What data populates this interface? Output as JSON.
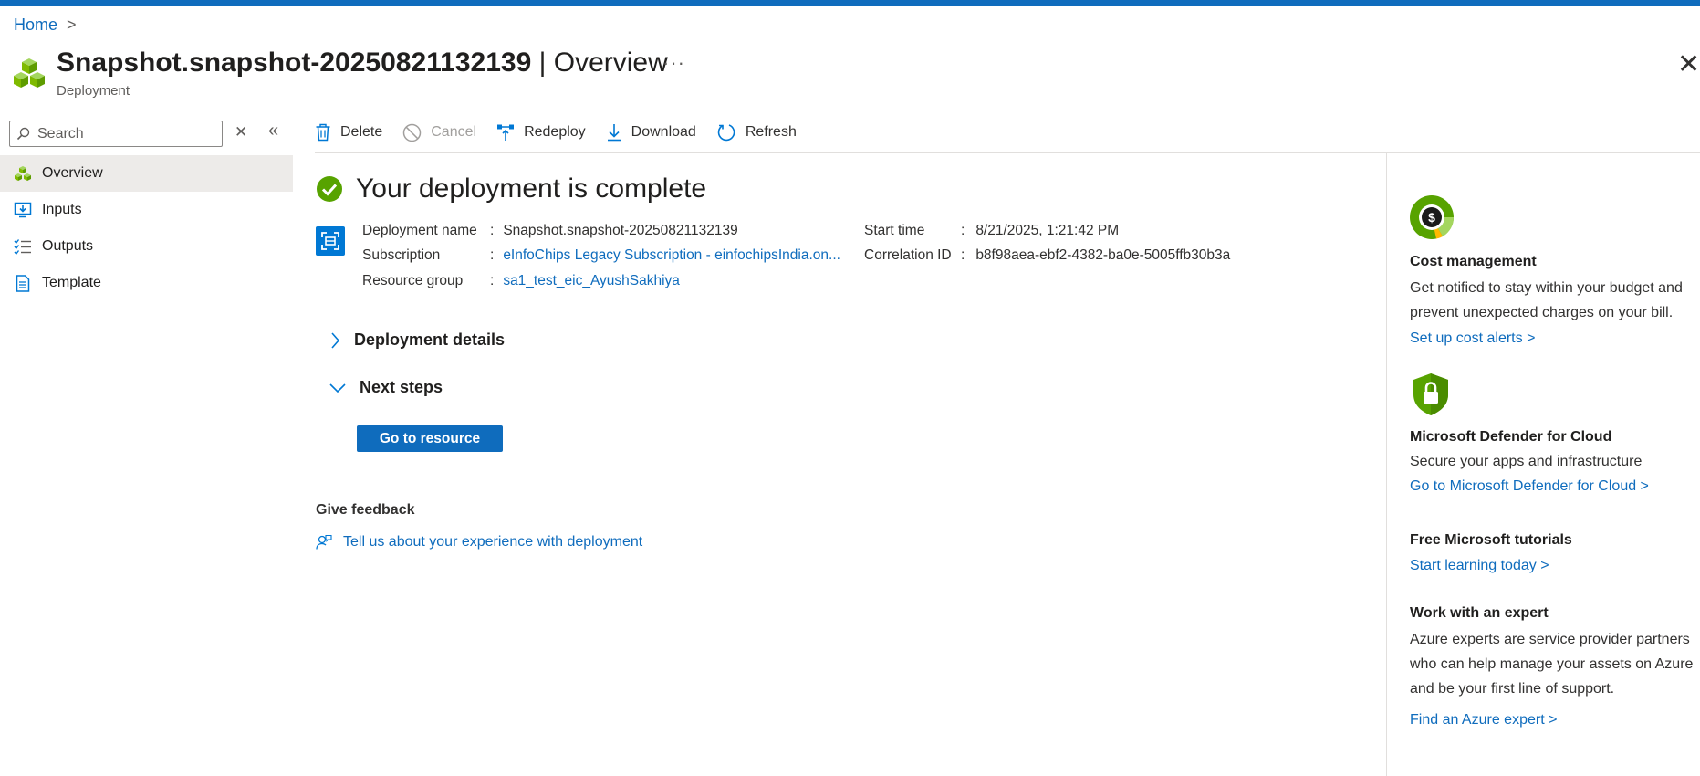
{
  "breadcrumb": {
    "home": "Home",
    "chevron": ">"
  },
  "header": {
    "name": "Snapshot.snapshot-20250821132139",
    "separator": " | ",
    "section": "Overview",
    "subtitle": "Deployment",
    "more": "···",
    "close": "✕"
  },
  "search": {
    "placeholder": "Search",
    "clear": "✕",
    "collapse": "«"
  },
  "sidebar": {
    "items": [
      {
        "label": "Overview",
        "icon": "overview-icon"
      },
      {
        "label": "Inputs",
        "icon": "inputs-icon"
      },
      {
        "label": "Outputs",
        "icon": "outputs-icon"
      },
      {
        "label": "Template",
        "icon": "template-icon"
      }
    ]
  },
  "toolbar": {
    "delete": "Delete",
    "cancel": "Cancel",
    "redeploy": "Redeploy",
    "download": "Download",
    "refresh": "Refresh"
  },
  "main": {
    "status": "Your deployment is complete",
    "details": {
      "deployment_name_label": "Deployment name",
      "deployment_name": "Snapshot.snapshot-20250821132139",
      "subscription_label": "Subscription",
      "subscription": "eInfoChips Legacy Subscription - einfochipsIndia.on...",
      "resource_group_label": "Resource group",
      "resource_group": "sa1_test_eic_AyushSakhiya",
      "start_time_label": "Start time",
      "start_time": "8/21/2025, 1:21:42 PM",
      "correlation_label": "Correlation ID",
      "correlation_id": "b8f98aea-ebf2-4382-ba0e-5005ffb30b3a",
      "colon": ":"
    },
    "deployment_details": "Deployment details",
    "next_steps": "Next steps",
    "go_to_resource": "Go to resource",
    "feedback_title": "Give feedback",
    "feedback_link": "Tell us about your experience with deployment"
  },
  "right_pane": {
    "cost": {
      "title": "Cost management",
      "text": "Get notified to stay within your budget and prevent unexpected charges on your bill.",
      "link": "Set up cost alerts >"
    },
    "defender": {
      "title": "Microsoft Defender for Cloud",
      "text": "Secure your apps and infrastructure",
      "link": "Go to Microsoft Defender for Cloud >"
    },
    "tutorials": {
      "title": "Free Microsoft tutorials",
      "link": "Start learning today >"
    },
    "expert": {
      "title": "Work with an expert",
      "text": "Azure experts are service provider partners who can help manage your assets on Azure and be your first line of support.",
      "link": "Find an Azure expert >"
    }
  },
  "colors": {
    "accent": "#0f6cbd",
    "success": "#57a300",
    "nav_active": "#edebe9"
  }
}
